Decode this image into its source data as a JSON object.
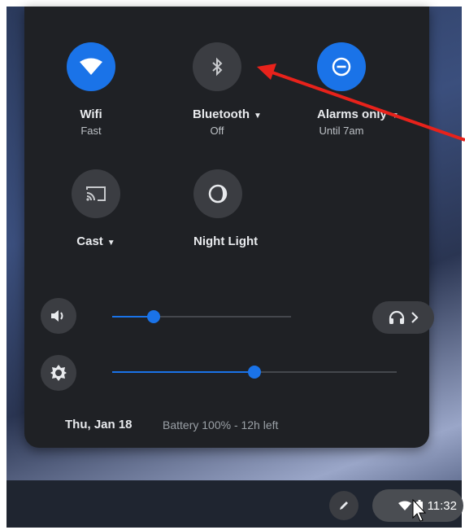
{
  "toggles": {
    "wifi": {
      "label": "Wifi",
      "sub": "Fast",
      "on": true
    },
    "bluetooth": {
      "label": "Bluetooth",
      "sub": "Off",
      "on": false
    },
    "alarms": {
      "label": "Alarms only",
      "sub": "Until 7am",
      "on": true
    },
    "cast": {
      "label": "Cast"
    },
    "night_light": {
      "label": "Night Light"
    }
  },
  "sliders": {
    "volume": {
      "level": 0.23,
      "icon": "speaker-icon"
    },
    "brightness": {
      "level": 0.5,
      "icon": "brightness-icon"
    }
  },
  "status": {
    "date": "Thu, Jan 18",
    "battery": "Battery 100% - 12h left"
  },
  "shelf": {
    "time": "11:32"
  },
  "colors": {
    "accent": "#1a73e8",
    "panel": "#1f2125",
    "annotation_arrow": "#e8221b"
  }
}
